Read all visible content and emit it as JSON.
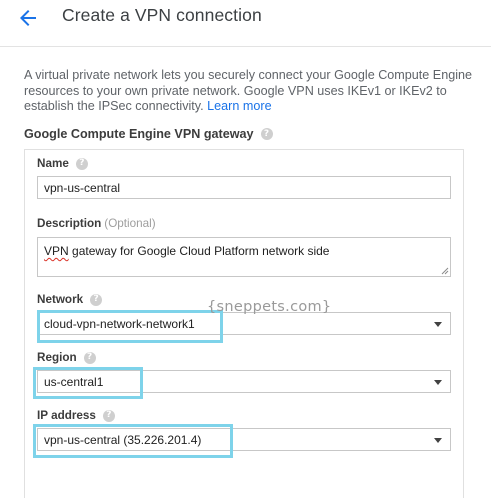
{
  "header": {
    "title": "Create a VPN connection",
    "back_icon": "arrow-back-icon",
    "accent": "#1a73e8"
  },
  "intro": {
    "text": "A virtual private network lets you securely connect your Google Compute Engine resources to your own private network. Google VPN uses IKEv1 or IKEv2 to establish the IPSec connectivity. ",
    "learn_more": "Learn more"
  },
  "gateway_section": {
    "title": "Google Compute Engine VPN gateway",
    "help_icon": "help-icon"
  },
  "form": {
    "name": {
      "label": "Name",
      "value": "vpn-us-central"
    },
    "description": {
      "label": "Description",
      "optional": "(Optional)",
      "value_flagged_word": "VPN",
      "value_rest": " gateway for Google Cloud Platform network side"
    },
    "network": {
      "label": "Network",
      "value": "cloud-vpn-network-network1"
    },
    "region": {
      "label": "Region",
      "value": "us-central1"
    },
    "ip_address": {
      "label": "IP address",
      "value": "vpn-us-central (35.226.201.4)"
    }
  },
  "watermark": "{sneppets.com}",
  "highlight_color": "#7ed3ea"
}
